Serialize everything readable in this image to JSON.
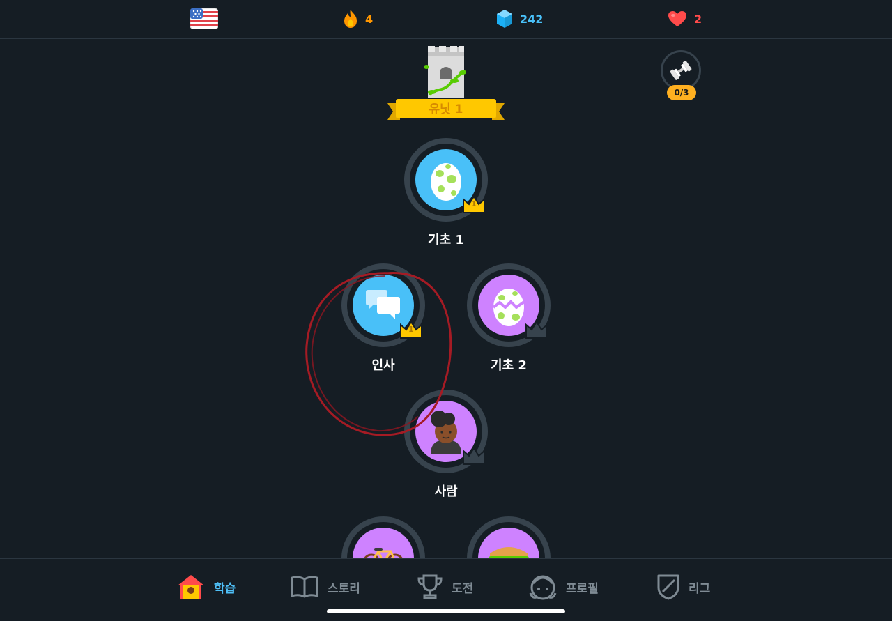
{
  "topbar": {
    "language_flag": "us-flag-icon",
    "streak": {
      "icon": "fire-icon",
      "value": "4",
      "color": "#ff9600"
    },
    "gems": {
      "icon": "gem-icon",
      "value": "242",
      "color": "#49c0f8"
    },
    "hearts": {
      "icon": "heart-icon",
      "value": "2",
      "color": "#ff4b4b"
    }
  },
  "unit": {
    "label": "유닛 1",
    "icon": "castle-icon"
  },
  "practice": {
    "icon": "dumbbell-icon",
    "progress": "0/3"
  },
  "skills": [
    {
      "name": "기초 1",
      "icon": "egg-icon",
      "color": "#49c0f8",
      "crown_level": "1",
      "crowned": true
    },
    {
      "name": "인사",
      "icon": "chat-bubbles-icon",
      "color": "#49c0f8",
      "crown_level": "1",
      "crowned": true
    },
    {
      "name": "기초 2",
      "icon": "cracked-egg-icon",
      "color": "#ce82ff",
      "crown_level": "",
      "crowned": false
    },
    {
      "name": "사람",
      "icon": "person-icon",
      "color": "#ce82ff",
      "crown_level": "",
      "crowned": false
    },
    {
      "name": "",
      "icon": "bicycle-icon",
      "color": "#ce82ff",
      "crowned": false
    },
    {
      "name": "",
      "icon": "sandwich-icon",
      "color": "#ce82ff",
      "crowned": false
    }
  ],
  "nav": {
    "items": [
      {
        "label": "학습",
        "icon": "home-icon",
        "active": true
      },
      {
        "label": "스토리",
        "icon": "book-icon",
        "active": false
      },
      {
        "label": "도전",
        "icon": "trophy-icon",
        "active": false
      },
      {
        "label": "프로필",
        "icon": "profile-icon",
        "active": false
      },
      {
        "label": "리그",
        "icon": "shield-icon",
        "active": false
      }
    ]
  },
  "colors": {
    "background": "#151d24",
    "accent": "#4fc0f8",
    "crown": "#ffc800",
    "inactive": "#37434d"
  }
}
